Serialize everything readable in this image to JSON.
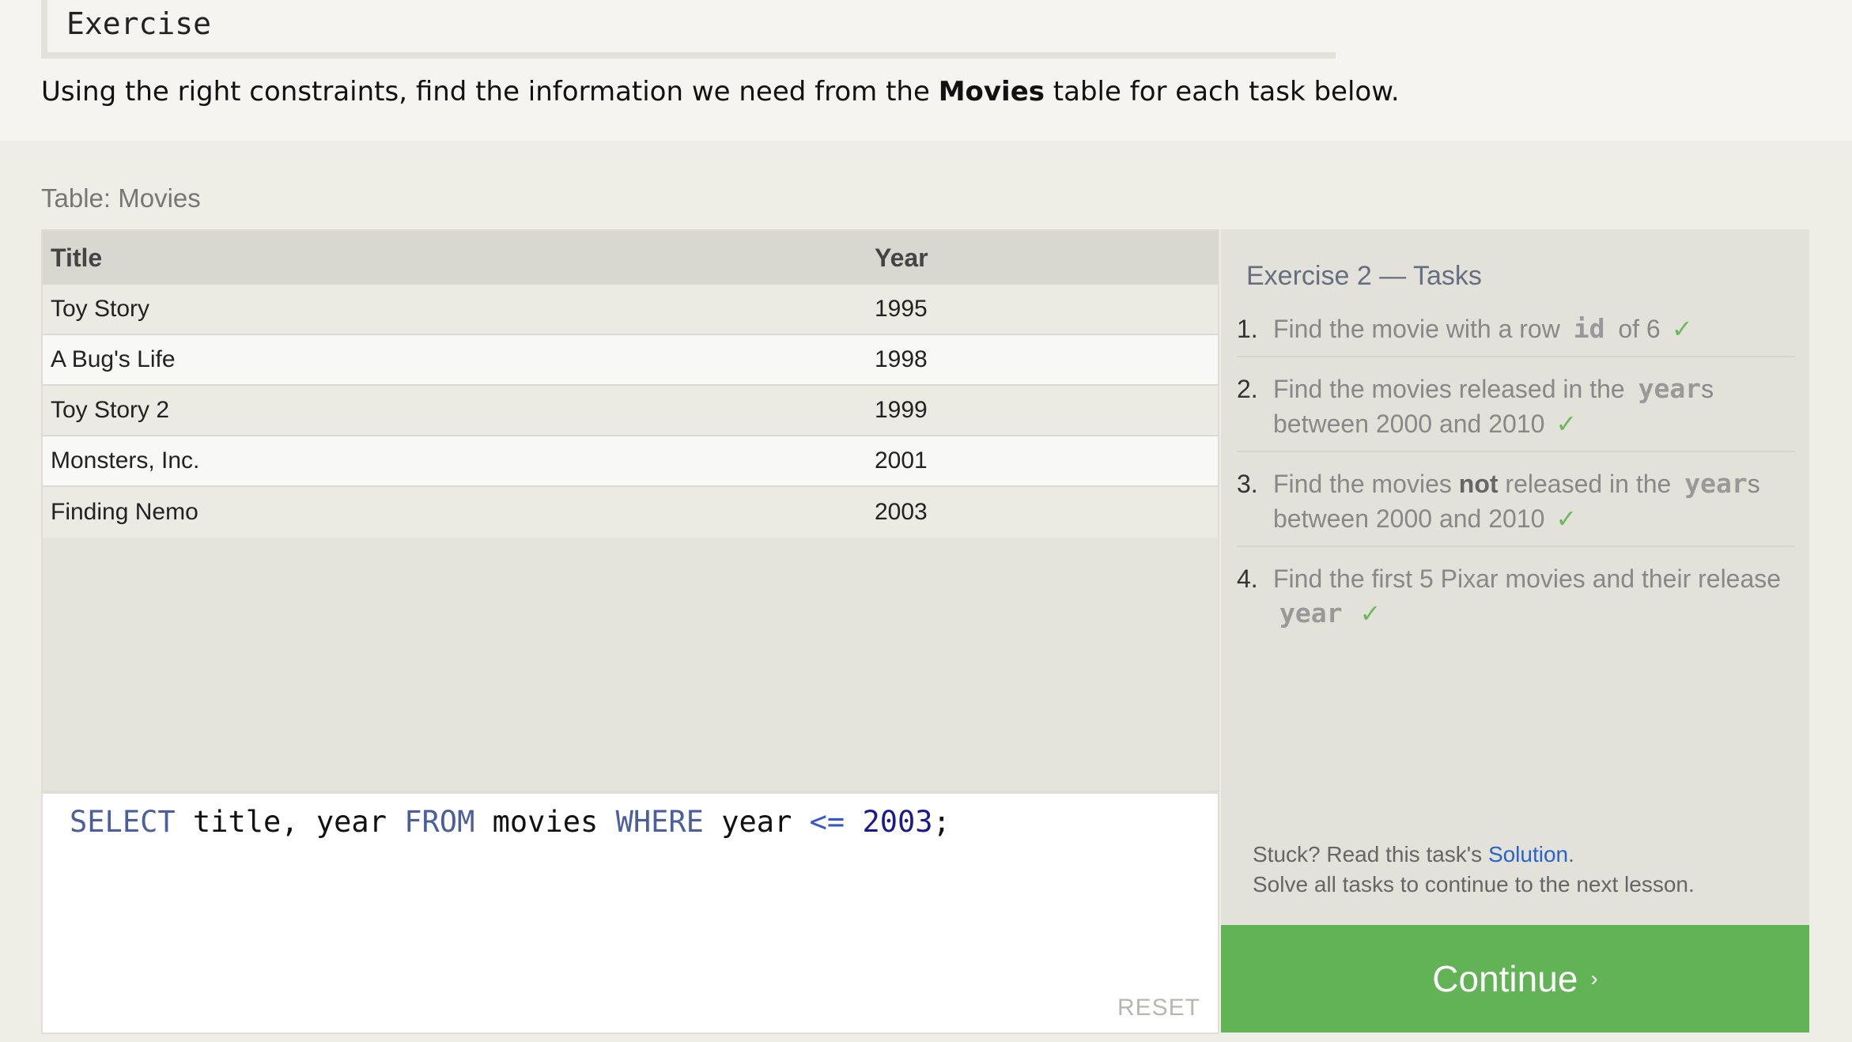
{
  "exercise": {
    "heading": "Exercise"
  },
  "intro": {
    "before": "Using the right constraints, find the information we need from the ",
    "bold": "Movies",
    "after": " table for each task below."
  },
  "table": {
    "label": "Table: Movies",
    "columns": [
      "Title",
      "Year"
    ],
    "rows": [
      [
        "Toy Story",
        "1995"
      ],
      [
        "A Bug's Life",
        "1998"
      ],
      [
        "Toy Story 2",
        "1999"
      ],
      [
        "Monsters, Inc.",
        "2001"
      ],
      [
        "Finding Nemo",
        "2003"
      ]
    ]
  },
  "editor": {
    "tokens": {
      "select": "SELECT",
      "cols": " title, year ",
      "from": "FROM",
      "table": " movies ",
      "where": "WHERE",
      "field": " year ",
      "op": "<=",
      "space": " ",
      "num": "2003",
      "semi": ";"
    },
    "reset_label": "RESET"
  },
  "tasks": {
    "title": "Exercise 2 — Tasks",
    "check": "✓",
    "items": [
      {
        "num": "1.",
        "pre": "Find the movie with a row ",
        "code": "id",
        "post": " of 6"
      },
      {
        "num": "2.",
        "pre": "Find the movies released in the ",
        "code": "year",
        "post": "s between 2000 and 2010"
      },
      {
        "num": "3.",
        "pre": "Find the movies ",
        "bold": "not",
        "mid": " released in the ",
        "code": "year",
        "post": "s between 2000 and 2010"
      },
      {
        "num": "4.",
        "pre": "Find the first 5 Pixar movies and their release ",
        "code": "year",
        "post": ""
      }
    ],
    "stuck_pre": "Stuck? Read this task's ",
    "solution_label": "Solution",
    "stuck_post": ".",
    "solve_all": "Solve all tasks to continue to the next lesson."
  },
  "continue": {
    "label": "Continue",
    "chevron": "›"
  },
  "colors": {
    "accent_green": "#62b356",
    "link_blue": "#2a63c7",
    "check_green": "#6cba5c"
  }
}
